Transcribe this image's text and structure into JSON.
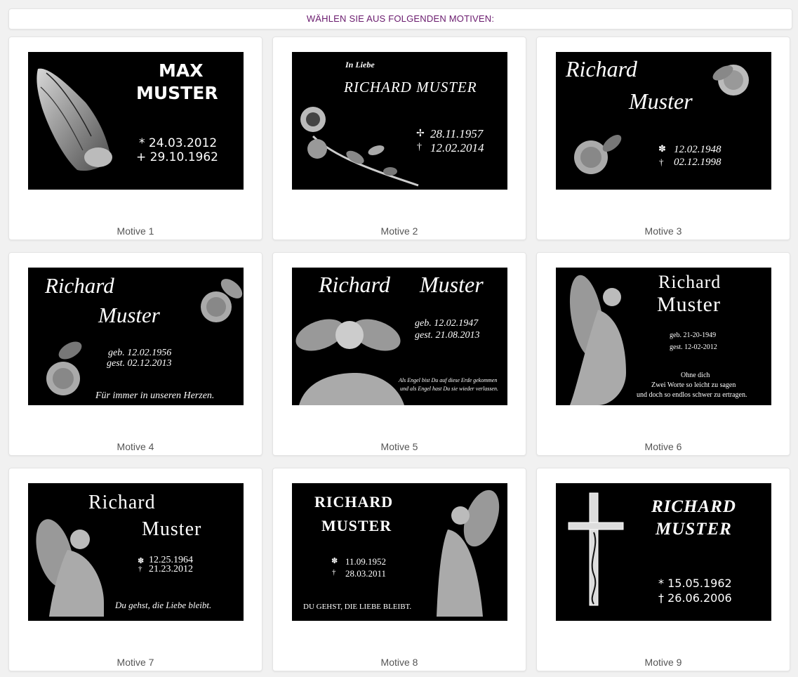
{
  "header": {
    "title": "WÄHLEN SIE AUS FOLGENDEN MOTIVEN:"
  },
  "motives": [
    {
      "caption": "Motive 1",
      "name1": "MAX",
      "name2": "MUSTER",
      "date1": "* 24.03.2012",
      "date2": "+ 29.10.1962"
    },
    {
      "caption": "Motive 2",
      "intro": "In Liebe",
      "name": "RICHARD MUSTER",
      "date1": "28.11.1957",
      "date2": "12.02.2014",
      "sym1": "✢",
      "sym2": "†"
    },
    {
      "caption": "Motive 3",
      "name1": "Richard",
      "name2": "Muster",
      "date1": "12.02.1948",
      "date2": "02.12.1998",
      "sym1": "✽",
      "sym2": "†"
    },
    {
      "caption": "Motive 4",
      "name1": "Richard",
      "name2": "Muster",
      "date1": "geb. 12.02.1956",
      "date2": "gest. 02.12.2013",
      "quote": "Für immer in unseren Herzen."
    },
    {
      "caption": "Motive 5",
      "name1": "Richard",
      "name2": "Muster",
      "date1": "geb. 12.02.1947",
      "date2": "gest. 21.08.2013",
      "quote1": "Als Engel bist Du auf diese Erde gekommen",
      "quote2": "und als Engel hast Du sie wieder verlassen."
    },
    {
      "caption": "Motive 6",
      "name1": "Richard",
      "name2": "Muster",
      "date1": "geb.   21-20-1949",
      "date2": "gest.  12-02-2012",
      "quote1": "Ohne dich",
      "quote2": "Zwei Worte so leicht zu sagen",
      "quote3": "und doch so endlos schwer zu ertragen."
    },
    {
      "caption": "Motive 7",
      "name1": "Richard",
      "name2": "Muster",
      "date1": "12.25.1964",
      "date2": "21.23.2012",
      "sym1": "✽",
      "sym2": "†",
      "quote": "Du gehst, die Liebe bleibt."
    },
    {
      "caption": "Motive 8",
      "name1": "RICHARD",
      "name2": "MUSTER",
      "date1": "11.09.1952",
      "date2": "28.03.2011",
      "sym1": "✽",
      "sym2": "†",
      "quote": "DU GEHST, DIE LIEBE BLEIBT."
    },
    {
      "caption": "Motive 9",
      "name1": "RICHARD",
      "name2": "MUSTER",
      "date1": "* 15.05.1962",
      "date2": "† 26.06.2006"
    }
  ]
}
